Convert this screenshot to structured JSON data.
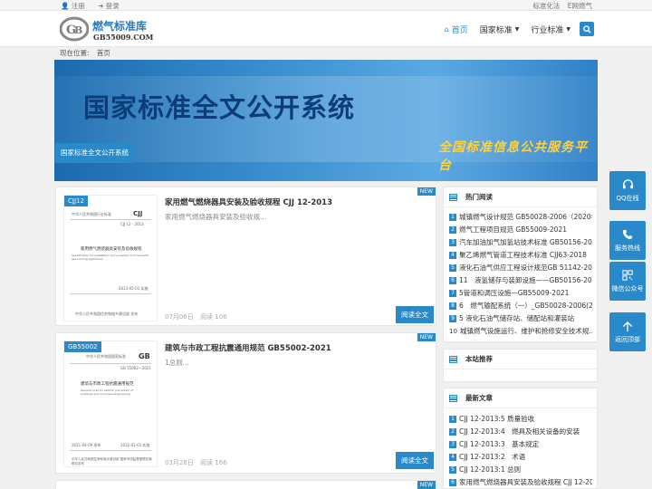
{
  "topbar": {
    "register": "注册",
    "login": "登录",
    "links": [
      "标准化法",
      "E网燃气"
    ]
  },
  "logo": {
    "cn": "燃气标准库",
    "en": "GB55009.COM"
  },
  "nav": {
    "items": [
      {
        "label": "首页",
        "active": true,
        "dropdown": false
      },
      {
        "label": "国家标准",
        "active": false,
        "dropdown": true
      },
      {
        "label": "行业标准",
        "active": false,
        "dropdown": true
      }
    ]
  },
  "breadcrumb": {
    "prefix": "现在位置:",
    "current": "首页"
  },
  "banner": {
    "title": "国家标准全文公开系统",
    "slogan": "全国标准信息公共服务平台",
    "tag": "国家标准全文公开系统"
  },
  "posts": [
    {
      "category": "CJJ12",
      "badge": "NEW",
      "title": "家用燃气燃烧器具安装及验收规程 CJJ 12-2013",
      "excerpt": "家用燃气燃烧器具安装及验收规...",
      "date": "07月06日",
      "reads": "阅读 106",
      "button": "阅读全文"
    },
    {
      "category": "GB55002",
      "badge": "NEW",
      "title": "建筑与市政工程抗震通用规范 GB55002-2021",
      "excerpt": "1总则...",
      "date": "03月28日",
      "reads": "阅读 166",
      "button": "阅读全文"
    },
    {
      "badge": "NEW"
    }
  ],
  "doc1": {
    "header": "中华人民共和国行业标准",
    "code": "CJJ",
    "num": "CJJ 12 - 2013",
    "title": "家用燃气燃烧器具安装及验收规程",
    "subtitle": "Specification for installation and acceptance of domestic gas burning appliances",
    "issue": "2013-05-01 实施",
    "publisher": "中华人民共和国住房和城乡建设部 发布"
  },
  "doc2": {
    "header": "中华人民共和国国家标准",
    "code": "GB",
    "num": "GB 55002—2021",
    "title": "建筑与市政工程抗震通用规范",
    "subtitle": "General code for seismic precaution of buildings and municipal engineering",
    "issue": "2021-04-09 发布",
    "effective": "2022-01-01 实施",
    "publisher": "中华人民共和国住房和城乡建设部 国家市场监督管理总局 联合发布"
  },
  "sidebar": {
    "hot": {
      "title": "热门阅读",
      "items": [
        {
          "num": "1",
          "text": "城镇燃气设计规范 GB50028-2006（2020年..."
        },
        {
          "num": "2",
          "text": "燃气工程项目规范 GB55009-2021"
        },
        {
          "num": "3",
          "text": "汽车加油加气加氢站技术标准 GB50156-2021"
        },
        {
          "num": "4",
          "text": "聚乙烯燃气管道工程技术标准 CJJ63-2018"
        },
        {
          "num": "5",
          "text": "液化石油气供应工程设计规范GB 51142-2015"
        },
        {
          "num": "6",
          "text": "11　液氢储存与装卸设施——GB50156-2021"
        },
        {
          "num": "7",
          "text": "5管道和调压设施—GB55009-2021"
        },
        {
          "num": "8",
          "text": "6　燃气输配系统（一）_GB50028-2006(20..."
        },
        {
          "num": "9",
          "text": "5 液化石油气储存站、储配站和灌装站"
        },
        {
          "num": "10",
          "text": "城镇燃气设施运行、维护和抢修安全技术规..."
        }
      ]
    },
    "recommend": {
      "title": "本站推荐"
    },
    "latest": {
      "title": "最新文章",
      "items": [
        {
          "num": "1",
          "text": "CJJ 12-2013:5 质量验收"
        },
        {
          "num": "2",
          "text": "CJJ 12-2013:4　燃具及相关设备的安装"
        },
        {
          "num": "3",
          "text": "CJJ 12-2013:3　基本规定"
        },
        {
          "num": "4",
          "text": "CJJ 12-2013:2　术语"
        },
        {
          "num": "5",
          "text": "CJJ 12-2013:1 总则"
        },
        {
          "num": "6",
          "text": "家用燃气燃烧器具安装及验收规程 CJJ  12-201"
        }
      ]
    }
  },
  "float": [
    {
      "label": "QQ在线",
      "icon": "headset-icon"
    },
    {
      "label": "服务热线",
      "icon": "phone-icon"
    },
    {
      "label": "微信公众号",
      "icon": "qrcode-icon"
    },
    {
      "label": "返回顶部",
      "icon": "arrow-up-icon"
    }
  ],
  "colors": {
    "accent": "#2a89c9",
    "banner_title": "#0c3d7a",
    "slogan": "#ffd23c"
  }
}
